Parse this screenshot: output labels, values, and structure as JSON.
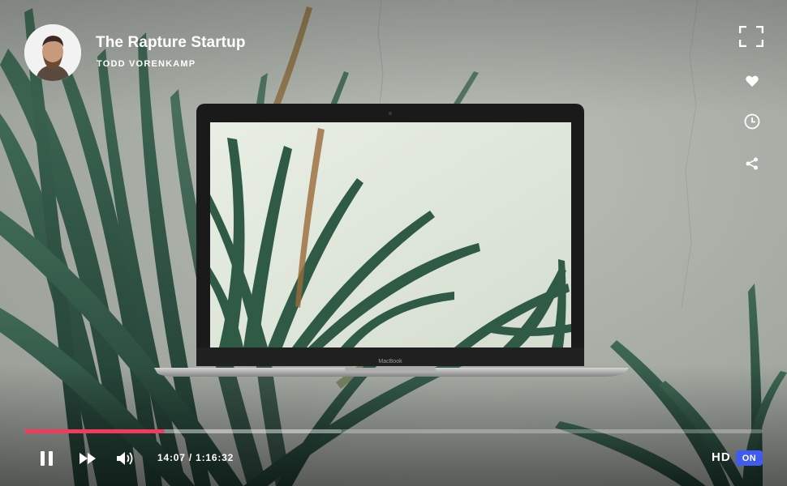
{
  "video": {
    "title": "The Rapture Startup",
    "author": "TODD VORENKAMP",
    "laptop_brand": "MacBook"
  },
  "progress": {
    "played_fraction": 0.19,
    "buffered_fraction": 0.43
  },
  "controls": {
    "play_state_icon": "pause-icon",
    "forward_icon": "fast-forward-icon",
    "volume_icon": "volume-icon",
    "current_time": "14:07",
    "separator": "/",
    "duration": "1:16:32",
    "hd_label": "HD",
    "hd_toggle": "ON"
  },
  "side_actions": [
    {
      "icon": "fullscreen-icon"
    },
    {
      "icon": "heart-icon"
    },
    {
      "icon": "clock-icon"
    },
    {
      "icon": "share-icon"
    }
  ],
  "colors": {
    "accent_progress": "#f23a5e",
    "hd_toggle_bg": "#3f5bf1",
    "text": "#ffffff"
  }
}
